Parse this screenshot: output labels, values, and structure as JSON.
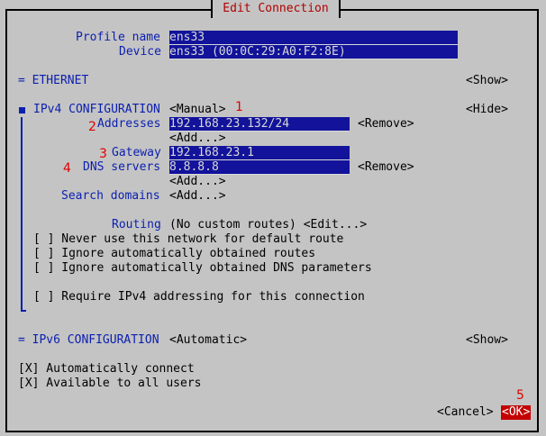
{
  "dialog": {
    "title": "Edit Connection"
  },
  "profile": {
    "name_label": "Profile name",
    "name_value": "ens33",
    "device_label": "Device",
    "device_value": "ens33 (00:0C:29:A0:F2:8E)"
  },
  "ethernet": {
    "label": "= ETHERNET",
    "toggle": "<Show>"
  },
  "ipv4": {
    "label": "IPv4 CONFIGURATION",
    "mode": "<Manual>",
    "toggle": "<Hide>",
    "addresses_label": "Addresses",
    "address_value": "192.168.23.132/24",
    "remove_label": "<Remove>",
    "add_label": "<Add...>",
    "gateway_label": "Gateway",
    "gateway_value": "192.168.23.1",
    "dns_label": "DNS servers",
    "dns_value": "8.8.8.8",
    "dns_remove": "<Remove>",
    "dns_add": "<Add...>",
    "search_label": "Search domains",
    "search_add": "<Add...>",
    "routing_label": "Routing",
    "routing_value": "(No custom routes) <Edit...>",
    "opt_never_default": "[ ] Never use this network for default route",
    "opt_ignore_routes": "[ ] Ignore automatically obtained routes",
    "opt_ignore_dns": "[ ] Ignore automatically obtained DNS parameters",
    "opt_require": "[ ] Require IPv4 addressing for this connection"
  },
  "ipv6": {
    "label": "= IPv6 CONFIGURATION",
    "mode": "<Automatic>",
    "toggle": "<Show>"
  },
  "general": {
    "auto_connect": "[X] Automatically connect",
    "all_users": "[X] Available to all users"
  },
  "buttons": {
    "cancel": "<Cancel>",
    "ok": "<OK>"
  },
  "annotations": {
    "n1": "1",
    "n2": "2",
    "n3": "3",
    "n4": "4",
    "n5": "5"
  },
  "colors": {
    "accent": "#0b1fb0",
    "field_bg": "#12139a",
    "ok_bg": "#c40000",
    "annotation": "#e00000"
  }
}
